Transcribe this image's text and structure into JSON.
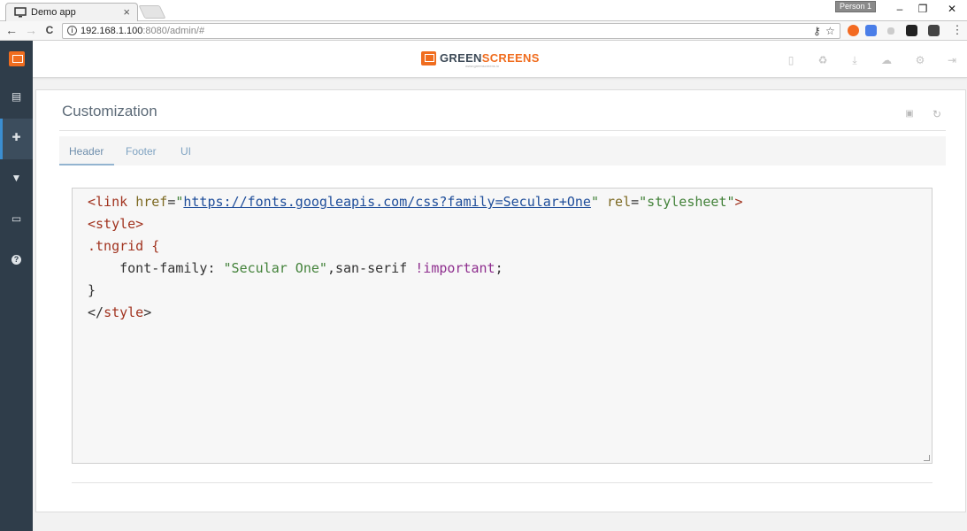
{
  "browser": {
    "tab_title": "Demo app",
    "tab_close": "×",
    "profile_label": "Person 1",
    "window_controls": {
      "minimize": "–",
      "restore": "❐",
      "close": "✕"
    },
    "nav": {
      "back": "←",
      "forward": "→",
      "reload": "C"
    },
    "url_host": "192.168.1.100",
    "url_path": ":8080/admin/#",
    "omnibox_icons": [
      "key-icon",
      "star-icon"
    ],
    "extensions": [
      {
        "name": "orange-extension-icon",
        "color": "#f36a21"
      },
      {
        "name": "translate-extension-icon",
        "color": "#4a7ee8"
      },
      {
        "name": "plus-extension-icon",
        "color": "#cccccc"
      },
      {
        "name": "ghostery-extension-icon",
        "color": "#222222"
      },
      {
        "name": "dark-extension-icon",
        "color": "#444444"
      }
    ],
    "menu": "⋮"
  },
  "app": {
    "brand_green": "GREEN",
    "brand_screens": "SCREENS",
    "brand_sub": "www.greenscreens.io",
    "accent": "#f06d1f",
    "sidebar_bg": "#2f3d4a",
    "header_icons": [
      "file-icon",
      "recycle-icon",
      "download-icon",
      "cloud-icon",
      "settings-icon",
      "logout-icon"
    ]
  },
  "sidebar": {
    "items": [
      {
        "name": "sidebar-item-dashboard",
        "icon": "table-icon",
        "glyph": "▤",
        "active": false
      },
      {
        "name": "sidebar-item-customization",
        "icon": "puzzle-icon",
        "glyph": "✚",
        "active": true
      },
      {
        "name": "sidebar-item-filter",
        "icon": "filter-icon",
        "glyph": "▼",
        "active": false
      },
      {
        "name": "sidebar-item-display",
        "icon": "monitor-icon",
        "glyph": "▭",
        "active": false
      },
      {
        "name": "sidebar-item-help",
        "icon": "help-icon",
        "glyph": "?",
        "active": false
      }
    ]
  },
  "panel": {
    "title": "Customization",
    "tools": [
      "save-icon",
      "refresh-icon"
    ],
    "tabs": [
      {
        "label": "Header",
        "active": true
      },
      {
        "label": "Footer",
        "active": false
      },
      {
        "label": "UI",
        "active": false
      }
    ]
  },
  "editor": {
    "line1": {
      "open": "<link ",
      "href_attr": "href",
      "eq1": "=",
      "q1": "\"",
      "href_value": "https://fonts.googleapis.com/css?family=Secular+One",
      "q2": "\"",
      "rel_attr": " rel",
      "eq2": "=",
      "rel_value": "\"stylesheet\"",
      "close": ">"
    },
    "line2": "<style>",
    "line3_selector": ".tngrid {",
    "line4": {
      "indent": "    ",
      "prop": "font-family: ",
      "value": "\"Secular One\"",
      "rest": ",san-serif ",
      "important": "!important",
      "semi": ";"
    },
    "line5": "}",
    "line6_open": "</",
    "line6_tag": "style",
    "line6_close": ">"
  }
}
